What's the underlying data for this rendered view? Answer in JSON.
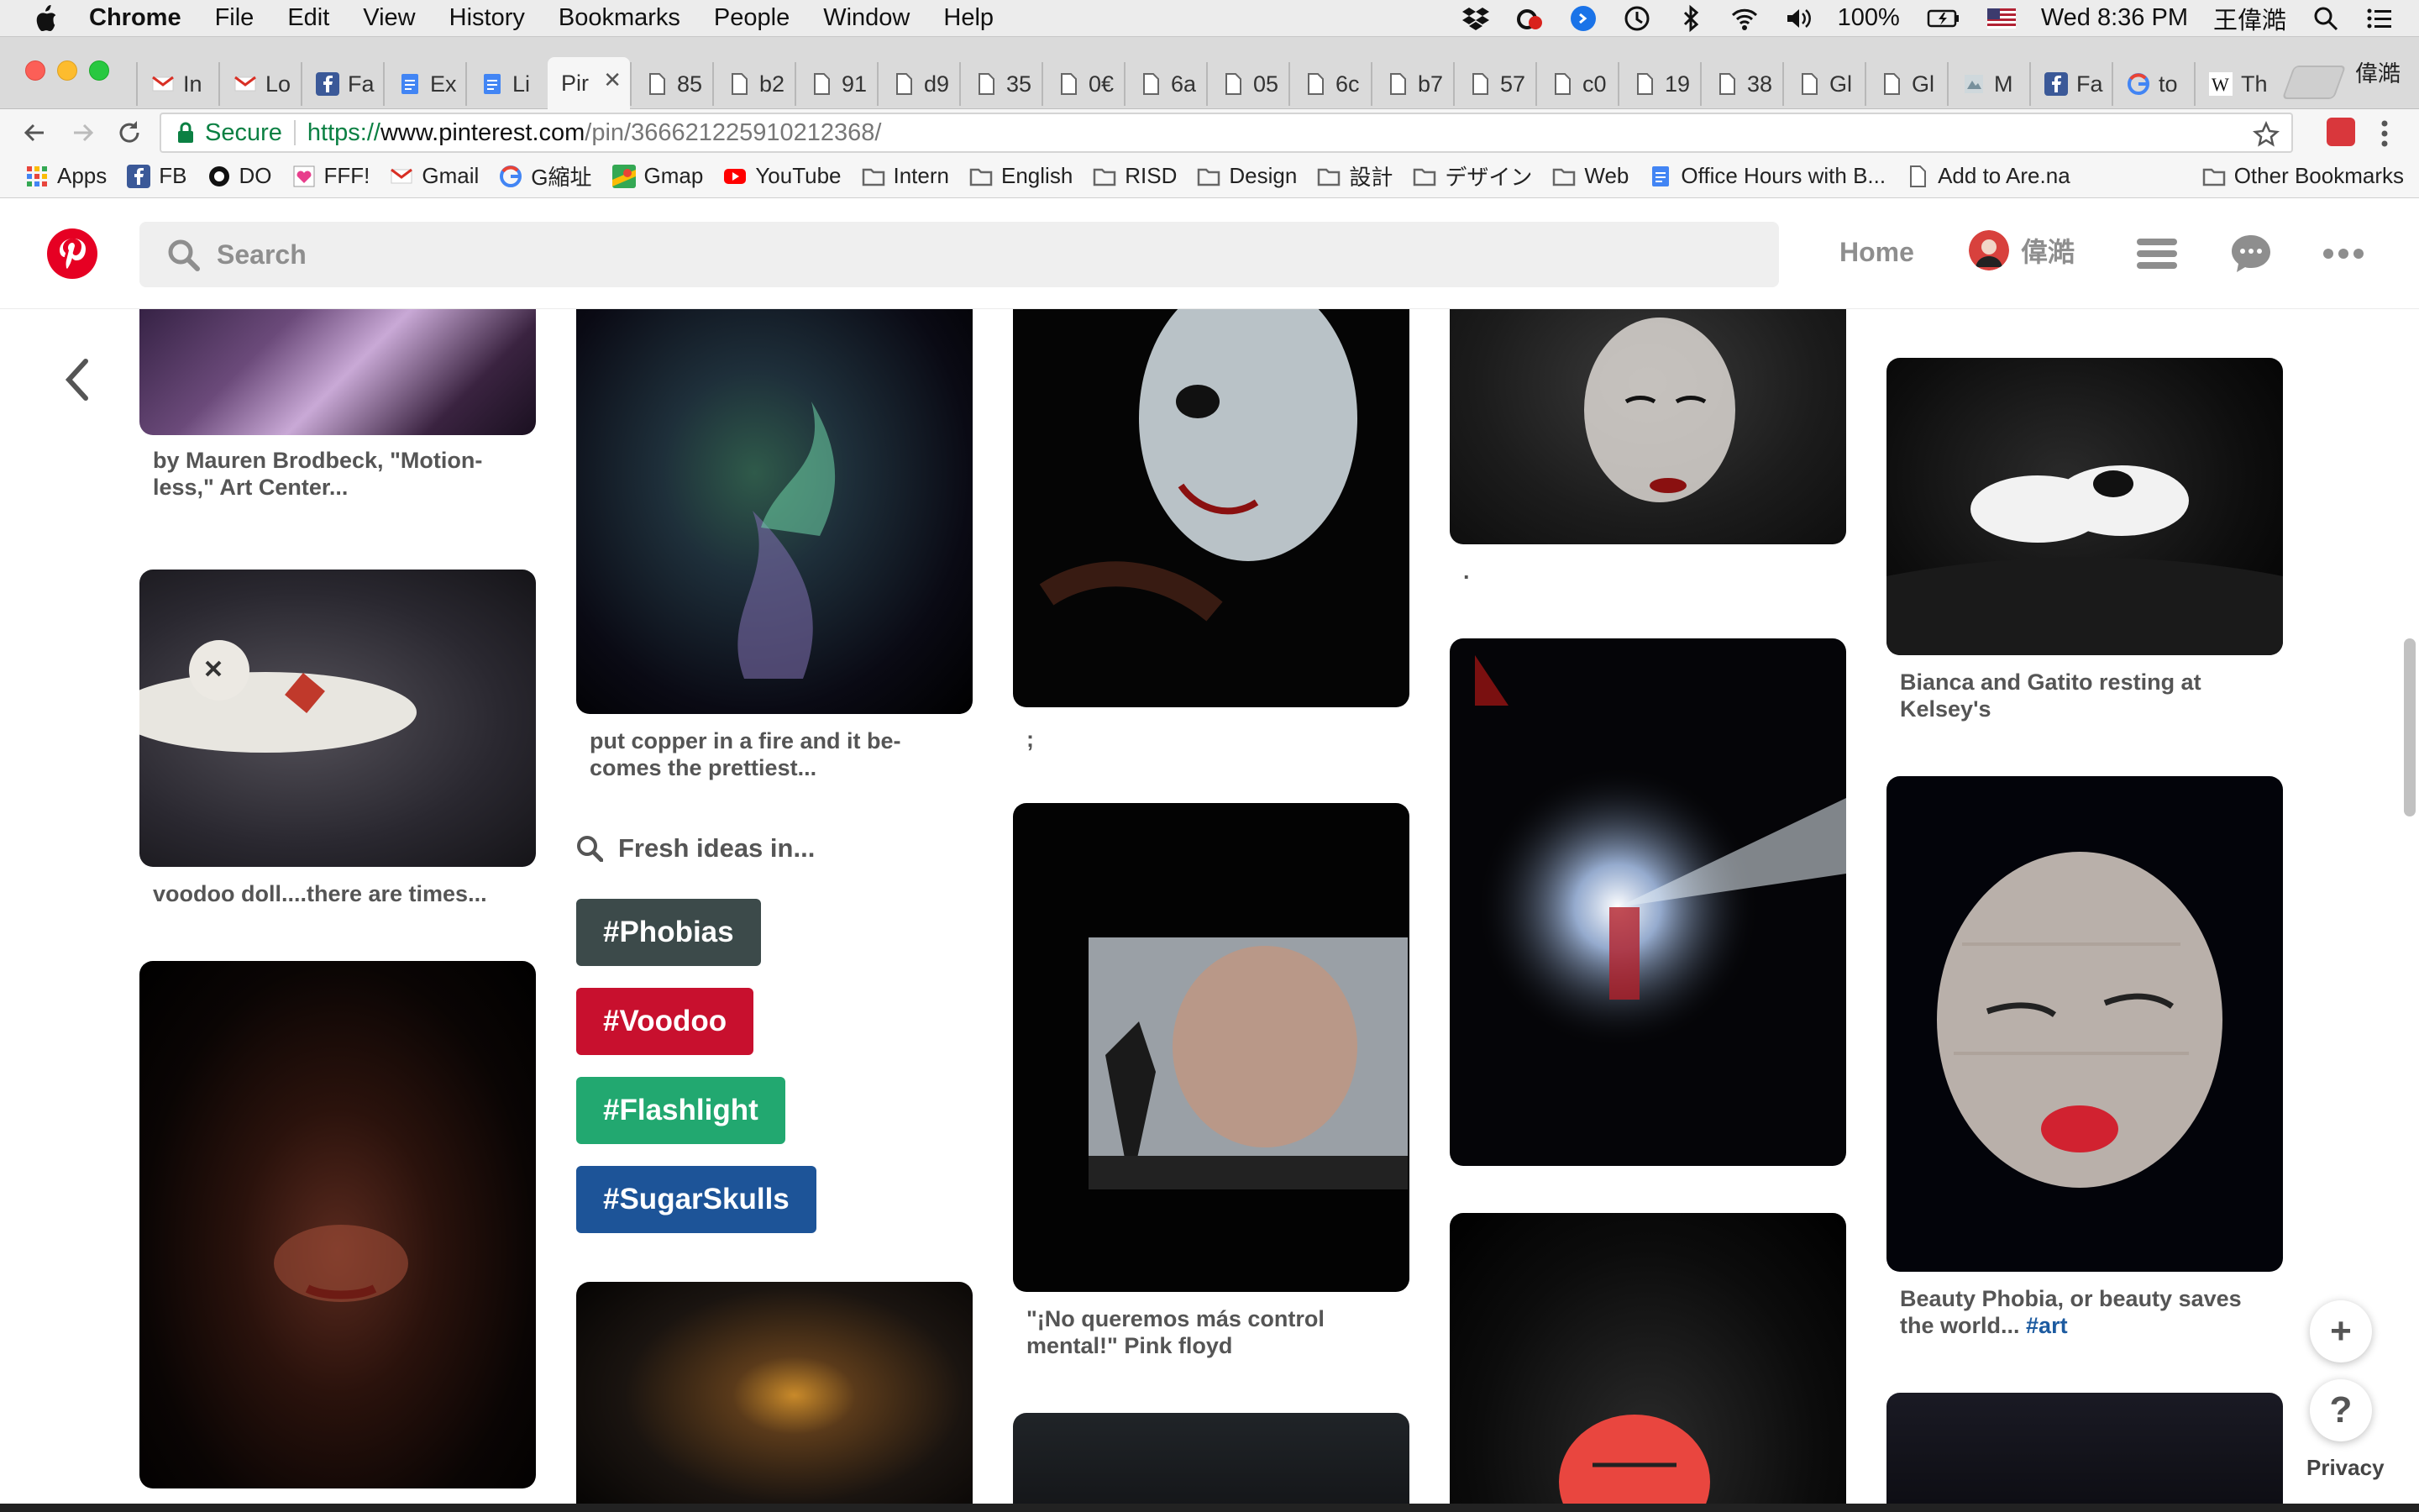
{
  "menubar": {
    "app_name": "Chrome",
    "menus": [
      "File",
      "Edit",
      "View",
      "History",
      "Bookmarks",
      "People",
      "Window",
      "Help"
    ],
    "battery": "100%",
    "clock": "Wed 8:36 PM",
    "user": "王偉澔"
  },
  "tabs": [
    {
      "label": "In",
      "icon": "gmail-icon"
    },
    {
      "label": "Lo",
      "icon": "gmail-icon"
    },
    {
      "label": "Fa",
      "icon": "facebook-icon"
    },
    {
      "label": "Ex",
      "icon": "google-docs-icon"
    },
    {
      "label": "Li",
      "icon": "google-docs-icon"
    },
    {
      "label": "Pir",
      "icon": "none",
      "active": true
    },
    {
      "label": "85",
      "icon": "page-icon"
    },
    {
      "label": "b2",
      "icon": "page-icon"
    },
    {
      "label": "91",
      "icon": "page-icon"
    },
    {
      "label": "d9",
      "icon": "page-icon"
    },
    {
      "label": "35",
      "icon": "page-icon"
    },
    {
      "label": "0€",
      "icon": "page-icon"
    },
    {
      "label": "6a",
      "icon": "page-icon"
    },
    {
      "label": "05",
      "icon": "page-icon"
    },
    {
      "label": "6c",
      "icon": "page-icon"
    },
    {
      "label": "b7",
      "icon": "page-icon"
    },
    {
      "label": "57",
      "icon": "page-icon"
    },
    {
      "label": "c0",
      "icon": "page-icon"
    },
    {
      "label": "19",
      "icon": "page-icon"
    },
    {
      "label": "38",
      "icon": "page-icon"
    },
    {
      "label": "Gl",
      "icon": "page-icon"
    },
    {
      "label": "Gl",
      "icon": "page-icon"
    },
    {
      "label": "M",
      "icon": "museum-icon"
    },
    {
      "label": "Fa",
      "icon": "facebook-icon"
    },
    {
      "label": "to",
      "icon": "google-icon"
    },
    {
      "label": "Th",
      "icon": "wikipedia-icon"
    }
  ],
  "profile_name": "偉澔",
  "omnibox": {
    "secure_label": "Secure",
    "url_scheme": "https://",
    "url_host": "www.pinterest.com",
    "url_path": "/pin/366621225910212368/"
  },
  "bookmarks": [
    {
      "label": "Apps",
      "icon": "apps-grid-icon"
    },
    {
      "label": "FB",
      "icon": "facebook-icon"
    },
    {
      "label": "DO",
      "icon": "digitalocean-icon"
    },
    {
      "label": "FFF!",
      "icon": "heart-icon"
    },
    {
      "label": "Gmail",
      "icon": "gmail-icon"
    },
    {
      "label": "G縮址",
      "icon": "google-icon"
    },
    {
      "label": "Gmap",
      "icon": "maps-icon"
    },
    {
      "label": "YouTube",
      "icon": "youtube-icon"
    },
    {
      "label": "Intern",
      "icon": "folder-icon"
    },
    {
      "label": "English",
      "icon": "folder-icon"
    },
    {
      "label": "RISD",
      "icon": "folder-icon"
    },
    {
      "label": "Design",
      "icon": "folder-icon"
    },
    {
      "label": "設計",
      "icon": "folder-icon"
    },
    {
      "label": "デザイン",
      "icon": "folder-icon"
    },
    {
      "label": "Web",
      "icon": "folder-icon"
    },
    {
      "label": "Office Hours with B...",
      "icon": "google-docs-icon"
    },
    {
      "label": "Add to Are.na",
      "icon": "page-icon"
    }
  ],
  "other_bookmarks": "Other Bookmarks",
  "pinterest": {
    "search_placeholder": "Search",
    "nav_home": "Home",
    "nav_user": "偉澔",
    "brand_color": "#e60023"
  },
  "pins": {
    "col1": [
      {
        "caption": "by Mauren Brodbeck, \"Motion-less,\" Art Center..."
      },
      {
        "caption": "voodoo doll....there are times..."
      },
      {
        "caption": ""
      }
    ],
    "col2": [
      {
        "caption": "put copper in a fire and it be-comes the prettiest..."
      },
      {
        "caption": ""
      }
    ],
    "col3": [
      {
        "caption": ";"
      },
      {
        "caption": "\"¡No queremos más control mental!\" Pink floyd"
      },
      {
        "caption": ""
      }
    ],
    "col4": [
      {
        "caption": "."
      },
      {
        "caption": ""
      },
      {
        "caption": ""
      }
    ],
    "col5": [
      {
        "caption": "Bianca and Gatito resting at Kelsey's"
      },
      {
        "caption": "Beauty Phobia, or beauty saves the world...",
        "tag": "#art"
      },
      {
        "caption": ""
      }
    ]
  },
  "fresh_ideas": {
    "heading": "Fresh ideas in...",
    "tags": [
      {
        "label": "#Phobias",
        "color": "#3c4a4a"
      },
      {
        "label": "#Voodoo",
        "color": "#c8102e"
      },
      {
        "label": "#Flashlight",
        "color": "#22a870"
      },
      {
        "label": "#SugarSkulls",
        "color": "#1d5498"
      }
    ]
  },
  "floating": {
    "add_label": "+",
    "help_label": "?",
    "privacy_label": "Privacy"
  }
}
